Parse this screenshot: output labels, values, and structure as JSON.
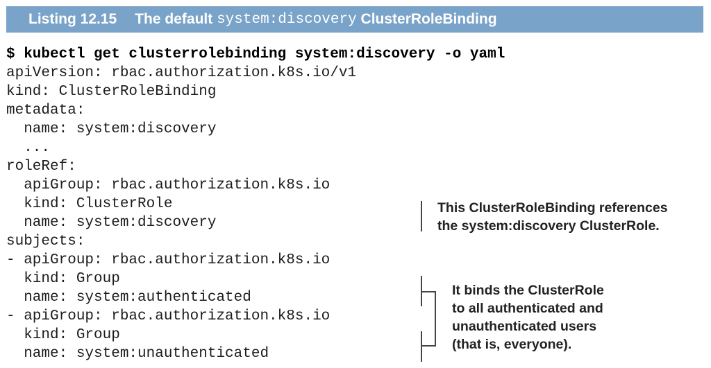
{
  "listing": {
    "label": "Listing 12.15",
    "title_prefix": "The default ",
    "title_code": "system:discovery",
    "title_suffix": " ClusterRoleBinding"
  },
  "code_lines": [
    "$ kubectl get clusterrolebinding system:discovery -o yaml",
    "apiVersion: rbac.authorization.k8s.io/v1",
    "kind: ClusterRoleBinding",
    "metadata:",
    "  name: system:discovery",
    "  ...",
    "roleRef:",
    "  apiGroup: rbac.authorization.k8s.io",
    "  kind: ClusterRole",
    "  name: system:discovery",
    "subjects:",
    "- apiGroup: rbac.authorization.k8s.io",
    "  kind: Group",
    "  name: system:authenticated",
    "- apiGroup: rbac.authorization.k8s.io",
    "  kind: Group",
    "  name: system:unauthenticated"
  ],
  "annotations": {
    "role_ref": {
      "line1": "This ClusterRoleBinding references",
      "line2": "the system:discovery ClusterRole."
    },
    "subjects": {
      "line1": "It binds the ClusterRole",
      "line2": "to all authenticated and",
      "line3": "unauthenticated users",
      "line4": "(that is, everyone)."
    }
  }
}
